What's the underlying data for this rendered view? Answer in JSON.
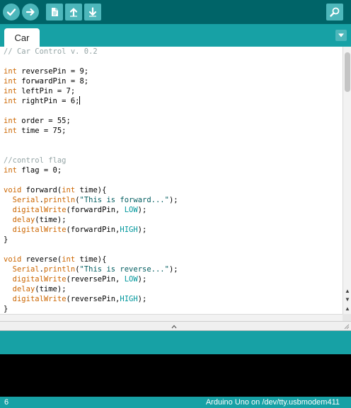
{
  "toolbar": {
    "buttons": [
      {
        "name": "verify",
        "icon": "checkmark-icon"
      },
      {
        "name": "upload",
        "icon": "arrow-right-icon"
      },
      {
        "name": "new",
        "icon": "new-file-icon"
      },
      {
        "name": "open",
        "icon": "arrow-up-icon"
      },
      {
        "name": "save",
        "icon": "arrow-down-icon"
      },
      {
        "name": "serial-monitor",
        "icon": "magnifier-icon"
      }
    ]
  },
  "tabs": [
    {
      "label": "Car",
      "active": true
    }
  ],
  "tab_menu_icon": "triangle-down-icon",
  "editor": {
    "lines": [
      [
        {
          "t": "// Car Control v. 0.2",
          "c": "comment"
        }
      ],
      [],
      [
        {
          "t": "int",
          "c": "type"
        },
        {
          "t": " reversePin = 9;",
          "c": "plain"
        }
      ],
      [
        {
          "t": "int",
          "c": "type"
        },
        {
          "t": " forwardPin = 8;",
          "c": "plain"
        }
      ],
      [
        {
          "t": "int",
          "c": "type"
        },
        {
          "t": " leftPin = 7;",
          "c": "plain"
        }
      ],
      [
        {
          "t": "int",
          "c": "type"
        },
        {
          "t": " rightPin = 6;",
          "c": "plain"
        },
        {
          "t": "",
          "c": "caret"
        }
      ],
      [],
      [
        {
          "t": "int",
          "c": "type"
        },
        {
          "t": " order = 55;",
          "c": "plain"
        }
      ],
      [
        {
          "t": "int",
          "c": "type"
        },
        {
          "t": " time = 75;",
          "c": "plain"
        }
      ],
      [],
      [],
      [
        {
          "t": "//control flag",
          "c": "comment"
        }
      ],
      [
        {
          "t": "int",
          "c": "type"
        },
        {
          "t": " flag = 0;",
          "c": "plain"
        }
      ],
      [],
      [
        {
          "t": "void",
          "c": "type"
        },
        {
          "t": " forward(",
          "c": "plain"
        },
        {
          "t": "int",
          "c": "type"
        },
        {
          "t": " time){",
          "c": "plain"
        }
      ],
      [
        {
          "t": "  ",
          "c": "plain"
        },
        {
          "t": "Serial",
          "c": "func"
        },
        {
          "t": ".",
          "c": "plain"
        },
        {
          "t": "println",
          "c": "func"
        },
        {
          "t": "(",
          "c": "plain"
        },
        {
          "t": "\"This is forward...\"",
          "c": "string"
        },
        {
          "t": ");",
          "c": "plain"
        }
      ],
      [
        {
          "t": "  ",
          "c": "plain"
        },
        {
          "t": "digitalWrite",
          "c": "func"
        },
        {
          "t": "(forwardPin, ",
          "c": "plain"
        },
        {
          "t": "LOW",
          "c": "const"
        },
        {
          "t": ");",
          "c": "plain"
        }
      ],
      [
        {
          "t": "  ",
          "c": "plain"
        },
        {
          "t": "delay",
          "c": "func"
        },
        {
          "t": "(time);",
          "c": "plain"
        }
      ],
      [
        {
          "t": "  ",
          "c": "plain"
        },
        {
          "t": "digitalWrite",
          "c": "func"
        },
        {
          "t": "(forwardPin,",
          "c": "plain"
        },
        {
          "t": "HIGH",
          "c": "const"
        },
        {
          "t": ");",
          "c": "plain"
        }
      ],
      [
        {
          "t": "}",
          "c": "plain"
        }
      ],
      [],
      [
        {
          "t": "void",
          "c": "type"
        },
        {
          "t": " reverse(",
          "c": "plain"
        },
        {
          "t": "int",
          "c": "type"
        },
        {
          "t": " time){",
          "c": "plain"
        }
      ],
      [
        {
          "t": "  ",
          "c": "plain"
        },
        {
          "t": "Serial",
          "c": "func"
        },
        {
          "t": ".",
          "c": "plain"
        },
        {
          "t": "println",
          "c": "func"
        },
        {
          "t": "(",
          "c": "plain"
        },
        {
          "t": "\"This is reverse...\"",
          "c": "string"
        },
        {
          "t": ");",
          "c": "plain"
        }
      ],
      [
        {
          "t": "  ",
          "c": "plain"
        },
        {
          "t": "digitalWrite",
          "c": "func"
        },
        {
          "t": "(reversePin, ",
          "c": "plain"
        },
        {
          "t": "LOW",
          "c": "const"
        },
        {
          "t": ");",
          "c": "plain"
        }
      ],
      [
        {
          "t": "  ",
          "c": "plain"
        },
        {
          "t": "delay",
          "c": "func"
        },
        {
          "t": "(time);",
          "c": "plain"
        }
      ],
      [
        {
          "t": "  ",
          "c": "plain"
        },
        {
          "t": "digitalWrite",
          "c": "func"
        },
        {
          "t": "(reversePin,",
          "c": "plain"
        },
        {
          "t": "HIGH",
          "c": "const"
        },
        {
          "t": ");",
          "c": "plain"
        }
      ],
      [
        {
          "t": "}",
          "c": "plain"
        }
      ]
    ]
  },
  "syntax_colors": {
    "comment": "#95a5a6",
    "type": "#cc6600",
    "func": "#cc6600",
    "string": "#005c5f",
    "const": "#00979c",
    "plain": "#000000"
  },
  "colors": {
    "toolbar_bg": "#006468",
    "accent": "#17a1a5",
    "button_bg": "#4db7bb",
    "console_bg": "#000000"
  },
  "status": {
    "line_number": "6",
    "board": "Arduino Uno on /dev/tty.usbmodem411"
  }
}
